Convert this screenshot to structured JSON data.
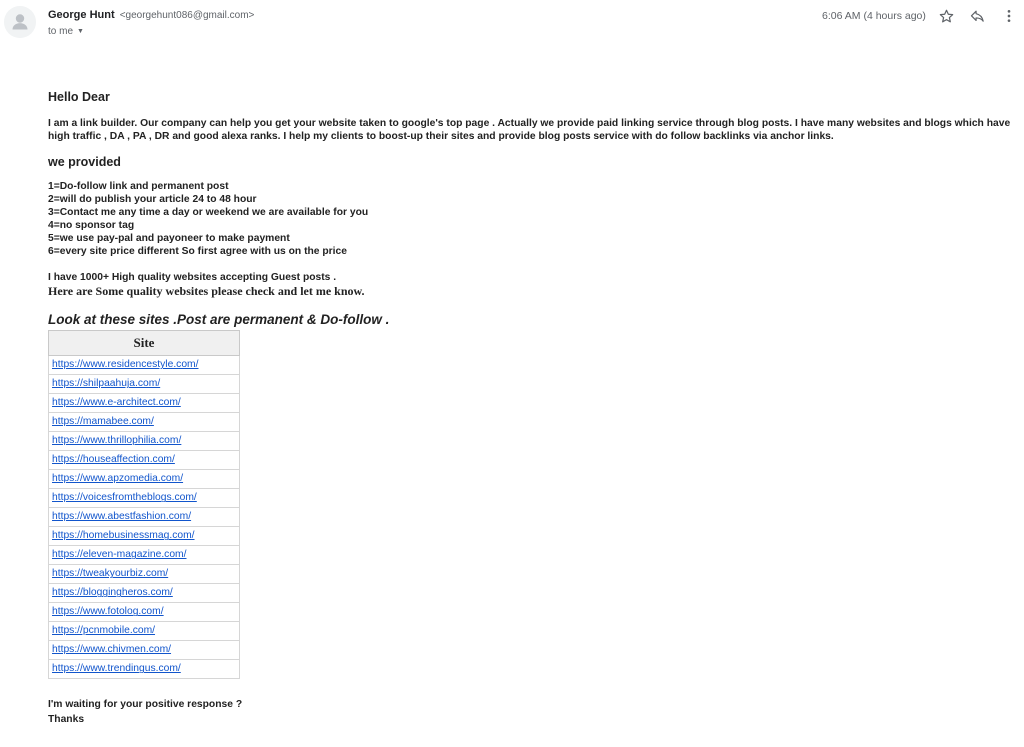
{
  "header": {
    "sender_name": "George Hunt",
    "sender_email": "<georgehunt086@gmail.com>",
    "recipient": "to me",
    "timestamp": "6:06 AM (4 hours ago)",
    "icons": [
      "person-avatar-icon",
      "star-icon",
      "reply-icon",
      "more-vert-icon",
      "chevron-down-icon"
    ]
  },
  "message": {
    "greeting": "Hello Dear",
    "intro": "I am a link builder. Our company can help you get your website taken to google's top page . Actually we provide paid linking service through blog posts. I have many websites and blogs which have high traffic , DA , PA , DR and good alexa ranks. I help my clients to boost-up their sites and provide blog posts service with do follow backlinks via anchor links.",
    "provided_title": "we provided",
    "provided_items": [
      "1=Do-follow link and permanent post",
      "2=will do publish your article 24 to 48 hour",
      "3=Contact me any time a day or weekend we are available for you",
      "4=no sponsor tag",
      "5=we use pay-pal and payoneer to make payment",
      "6=every site price different So first agree with us on the price"
    ],
    "sites_count": "I have 1000+ High quality websites accepting Guest posts .",
    "quality_note": "Here are Some quality websites please check and let me know.",
    "sites_heading": "Look at these sites .Post are permanent & Do-follow .",
    "table_header": "Site",
    "sites": [
      "https://www.residencestyle.com/",
      "https://shilpaahuja.com/",
      "https://www.e-architect.com/",
      "https://mamabee.com/",
      "https://www.thrillophilia.com/",
      "https://houseaffection.com/",
      "https://www.apzomedia.com/",
      "https://voicesfromtheblogs.com/",
      "https://www.abestfashion.com/",
      "https://homebusinessmag.com/",
      "https://eleven-magazine.com/",
      "https://tweakyourbiz.com/",
      "https://bloggingheros.com/",
      "https://www.fotolog.com/",
      "https://pcnmobile.com/",
      "https://www.chivmen.com/",
      "https://www.trendingus.com/"
    ],
    "closing_line": "I'm waiting for your positive response ?",
    "signoff": "Thanks"
  },
  "colors": {
    "link": "#1155cc",
    "text": "#222222",
    "muted": "#5f6368",
    "table_header_bg": "#f0f0f0"
  }
}
